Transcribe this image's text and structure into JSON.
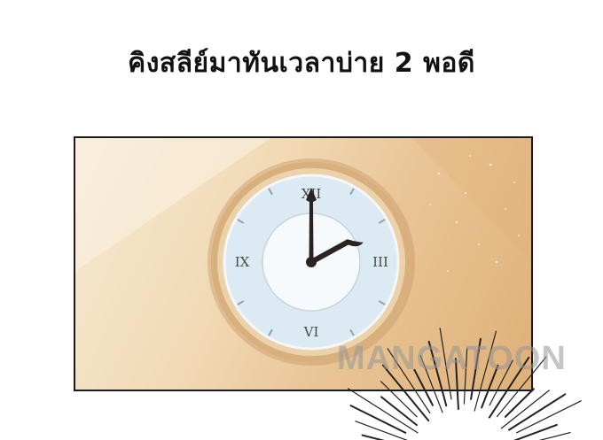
{
  "caption": "คิงสลีย์มาทันเวลาบ่าย 2 พอดี",
  "clock": {
    "numerals": {
      "top": "XII",
      "right": "III",
      "bottom": "VI",
      "left": "IX"
    },
    "time": {
      "hour": 2,
      "minute": 0
    }
  },
  "watermark": "MANGATOON",
  "colors": {
    "frame": "#d8b07e",
    "face": "#dcebf3",
    "hands": "#2b2323"
  }
}
